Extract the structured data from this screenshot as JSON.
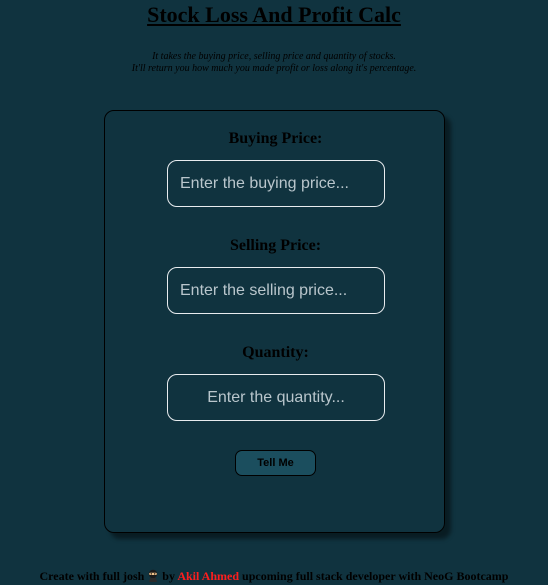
{
  "header": {
    "title": "Stock Loss And Profit Calc",
    "subtitle_line1": "It takes the buying price, selling price and quantity of stocks.",
    "subtitle_line2": "It'll return you how much you made profit or loss along it's percentage."
  },
  "form": {
    "buying": {
      "label": "Buying Price:",
      "value": "",
      "placeholder": "Enter the buying price..."
    },
    "selling": {
      "label": "Selling Price:",
      "value": "",
      "placeholder": "Enter the selling price..."
    },
    "quantity": {
      "label": "Quantity:",
      "value": "",
      "placeholder": "Enter the quantity..."
    },
    "submit_label": "Tell Me"
  },
  "footer": {
    "prefix": "Create with full josh",
    "emoji_icon": "ninja-emoji-icon",
    "by": "by",
    "author": "Akil Ahmed",
    "suffix": "upcoming full stack developer with NeoG Bootcamp"
  },
  "colors": {
    "background": "#10333f",
    "input_border": "#e8ecef",
    "button_bg": "#1b4e5e",
    "author": "#ff1e1e"
  }
}
